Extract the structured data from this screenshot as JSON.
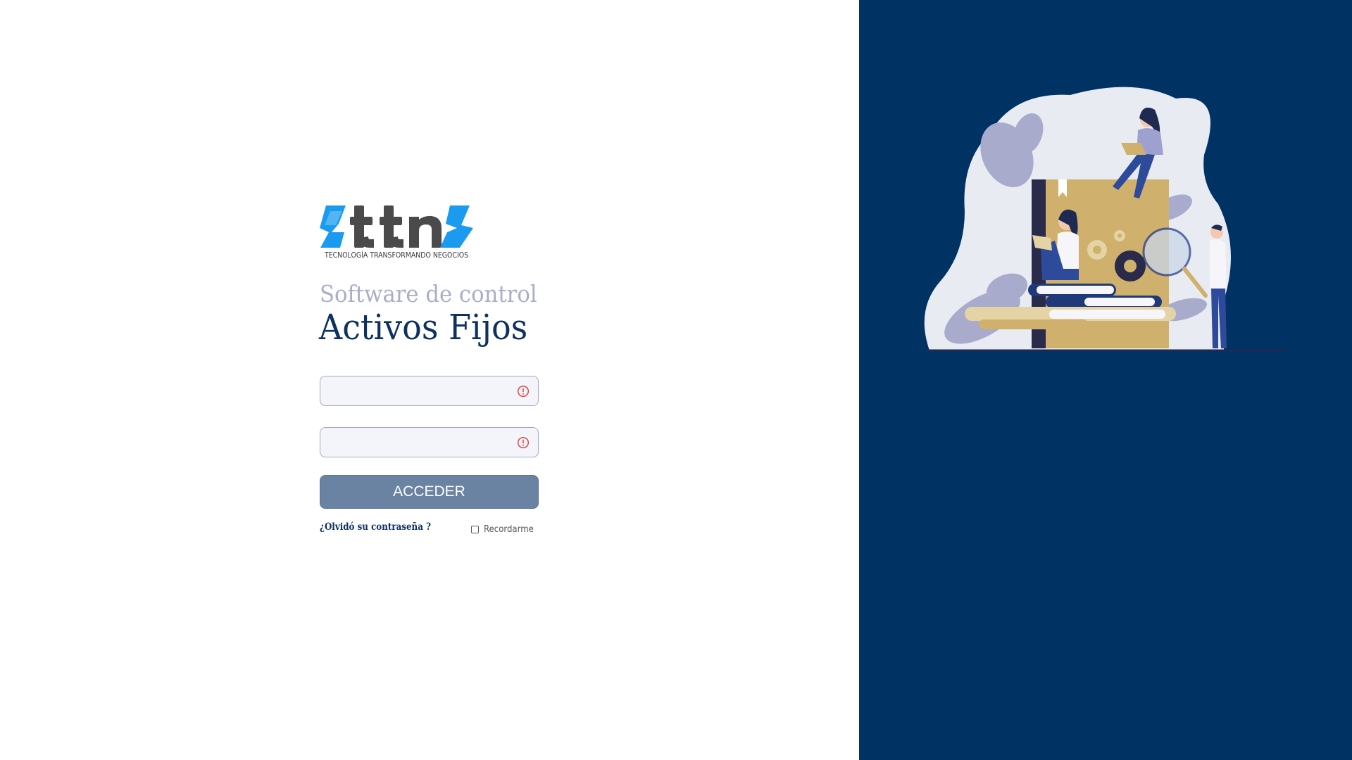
{
  "brand": {
    "logo_text": "ttn",
    "tagline": "TECNOLOGÍA TRANSFORMANDO NEGOCIOS",
    "colors": {
      "logo_blue": "#1a9bf0",
      "logo_dark": "#4a4a4a",
      "navy": "#003263",
      "title_navy": "#0d3161",
      "subtitle_lavender": "#a9aeca"
    }
  },
  "header": {
    "subtitle": "Software de control",
    "title": "Activos Fijos"
  },
  "login_form": {
    "username": {
      "value": "",
      "placeholder": "",
      "status_icon": "error-circle-icon"
    },
    "password": {
      "value": "",
      "placeholder": "",
      "status_icon": "error-circle-icon"
    },
    "submit_label": "ACCEDER",
    "forgot_password_label": "¿Olvidó su contraseña ?",
    "remember_label": "Recordarme",
    "remember_checked": false
  },
  "side_panel": {
    "illustration": "team-working-with-book-gears-magnifier-illustration"
  }
}
